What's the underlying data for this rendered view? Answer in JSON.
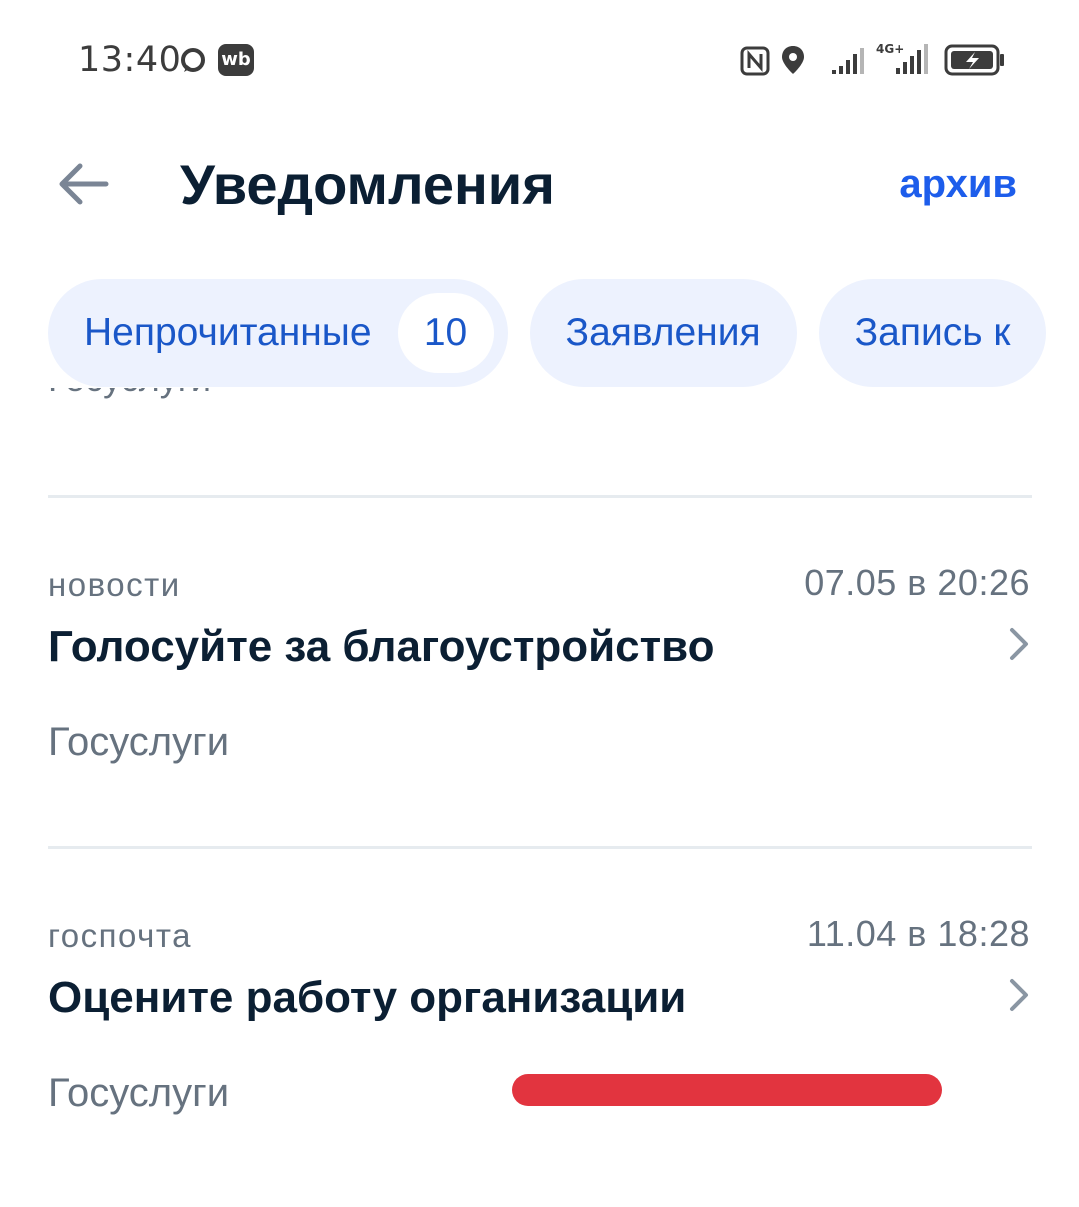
{
  "status_bar": {
    "time": "13:40",
    "wb_label": "wb",
    "network_label": "4G+"
  },
  "header": {
    "title": "Уведомления",
    "archive_label": "архив"
  },
  "filters": [
    {
      "label": "Непрочитанные",
      "count": "10"
    },
    {
      "label": "Заявления"
    },
    {
      "label": "Запись к"
    }
  ],
  "partial_item_source": "Госуслуги",
  "notifications": [
    {
      "category": "новости",
      "timestamp": "07.05 в 20:26",
      "title": "Голосуйте за благоустройство",
      "source": "Госуслуги"
    },
    {
      "category": "госпочта",
      "timestamp": "11.04 в 18:28",
      "title": "Оцените работу организации",
      "source": "Госуслуги"
    }
  ],
  "colors": {
    "accent": "#1a57c8",
    "chip_background": "#edf2fe",
    "title_text": "#0b1f33",
    "secondary_text": "#66727f",
    "redaction": "#e2343f"
  }
}
